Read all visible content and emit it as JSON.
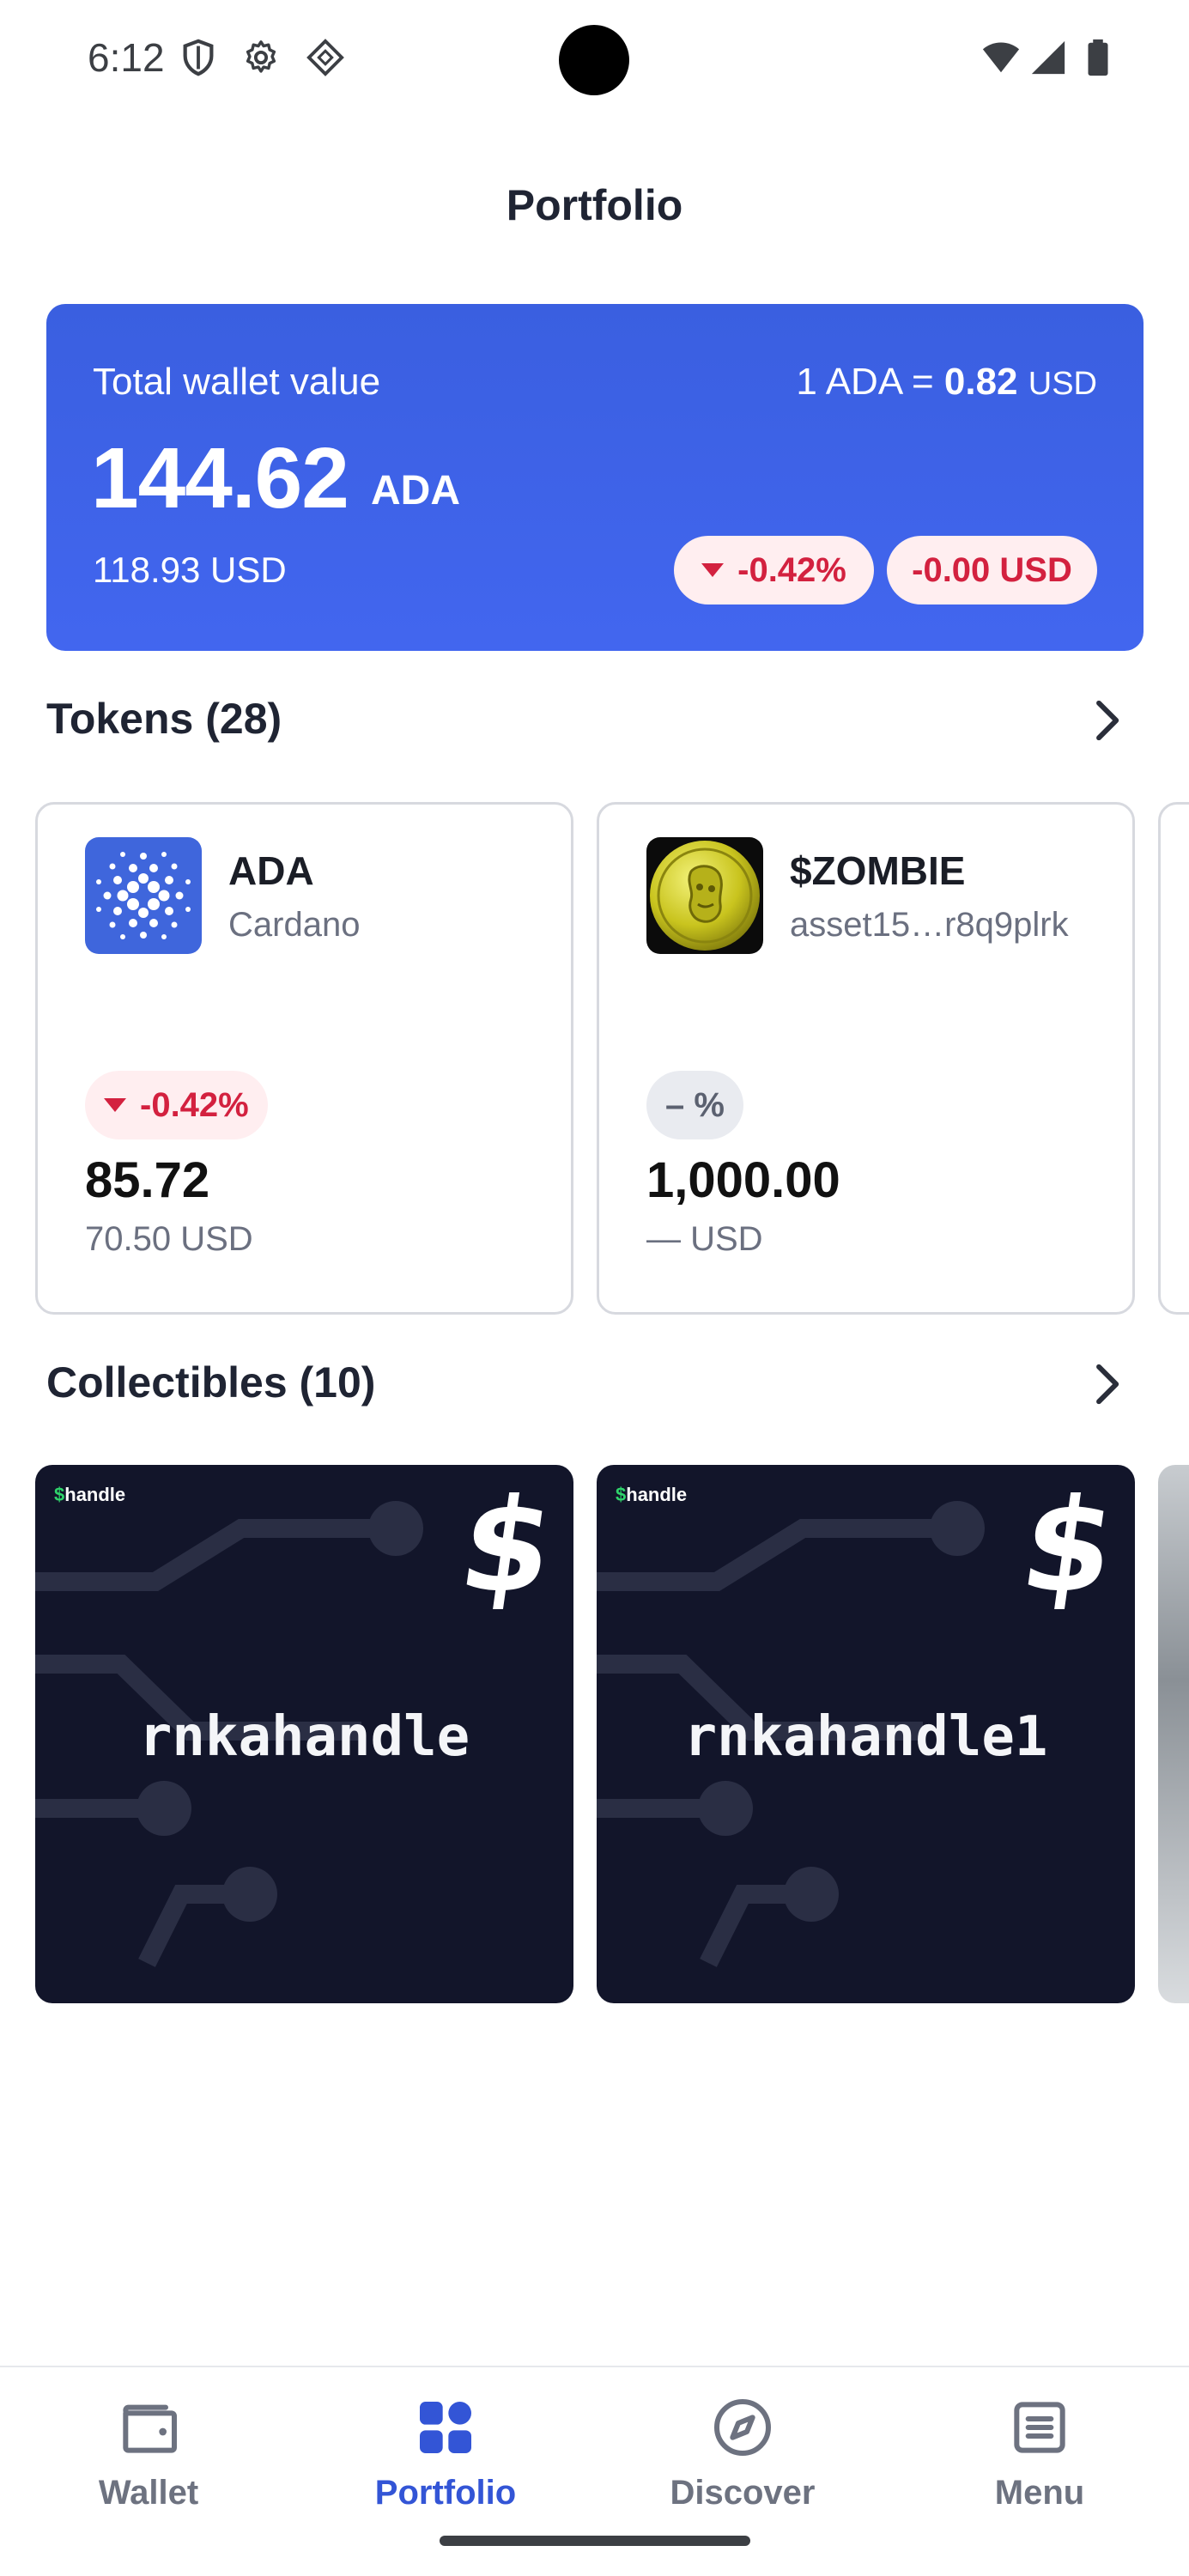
{
  "status_bar": {
    "time": "6:12",
    "icons": [
      "shield-icon",
      "gear-icon",
      "diamond-icon",
      "wifi-icon",
      "signal-icon",
      "battery-icon"
    ]
  },
  "header": {
    "title": "Portfolio"
  },
  "wallet": {
    "label": "Total wallet value",
    "rate_prefix": "1 ADA = ",
    "rate_value": "0.82",
    "rate_unit": "USD",
    "value": "144.62",
    "value_unit": "ADA",
    "usd_value": "118.93 USD",
    "change_percent": "-0.42%",
    "change_usd": "-0.00 USD",
    "colors": {
      "card": "#4266ef",
      "negative": "#d3213f",
      "negative_bg": "#ffeef0"
    }
  },
  "tokens": {
    "title": "Tokens (28)",
    "items": [
      {
        "name": "ADA",
        "subtitle": "Cardano",
        "change": "-0.42%",
        "amount": "85.72",
        "usd": "70.50 USD",
        "icon": "cardano-icon"
      },
      {
        "name": "$ZOMBIE",
        "subtitle": "asset15…r8q9plrk",
        "change": "– %",
        "amount": "1,000.00",
        "usd": "— USD",
        "icon": "zombie-coin-icon"
      }
    ]
  },
  "collectibles": {
    "title": "Collectibles (10)",
    "items": [
      {
        "brand_symbol": "$",
        "brand": "handle",
        "name": "rnkahandle"
      },
      {
        "brand_symbol": "$",
        "brand": "handle",
        "name": "rnkahandle1"
      }
    ]
  },
  "nav": {
    "items": [
      {
        "label": "Wallet",
        "icon": "wallet-icon",
        "active": false
      },
      {
        "label": "Portfolio",
        "icon": "portfolio-icon",
        "active": true
      },
      {
        "label": "Discover",
        "icon": "compass-icon",
        "active": false
      },
      {
        "label": "Menu",
        "icon": "menu-icon",
        "active": false
      }
    ],
    "colors": {
      "active": "#3355d6",
      "inactive": "#6d7280"
    }
  }
}
